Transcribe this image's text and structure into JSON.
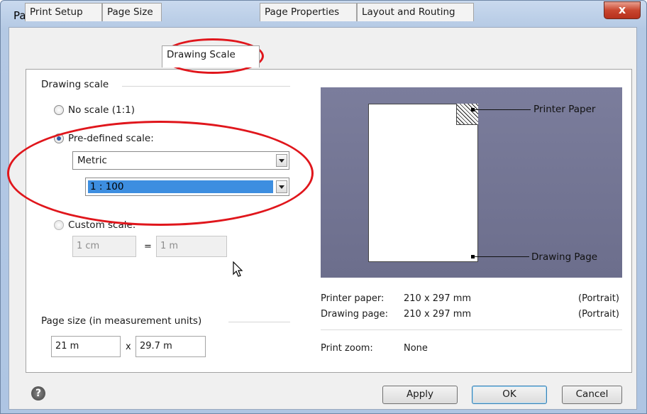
{
  "window": {
    "title": "Page Setup",
    "close_glyph": "x"
  },
  "tabs": [
    {
      "label": "Print Setup"
    },
    {
      "label": "Page Size"
    },
    {
      "label": "Drawing Scale"
    },
    {
      "label": "Page Properties"
    },
    {
      "label": "Layout and Routing"
    }
  ],
  "drawing_scale": {
    "group_label": "Drawing scale",
    "no_scale_label": "No scale (1:1)",
    "predefined_label": "Pre-defined scale:",
    "predefined_type": "Metric",
    "predefined_value": "1 : 100",
    "custom_label": "Custom scale:",
    "custom_left": "1 cm",
    "custom_equals": "=",
    "custom_right": "1 m",
    "selected_option": "predefined"
  },
  "page_size": {
    "group_label": "Page size (in measurement units)",
    "width": "21 m",
    "times": "x",
    "height": "29.7 m"
  },
  "preview": {
    "printer_paper_callout": "Printer Paper",
    "drawing_page_callout": "Drawing Page"
  },
  "info": {
    "printer_paper_label": "Printer paper:",
    "printer_paper_size": "210 x 297 mm",
    "printer_paper_orientation": "(Portrait)",
    "drawing_page_label": "Drawing page:",
    "drawing_page_size": "210 x 297 mm",
    "drawing_page_orientation": "(Portrait)",
    "print_zoom_label": "Print zoom:",
    "print_zoom_value": "None"
  },
  "buttons": {
    "help_glyph": "?",
    "apply": "Apply",
    "ok": "OK",
    "cancel": "Cancel"
  },
  "colors": {
    "annotation_ellipse": "#e0161c",
    "preview_bg": "#6c6e8c",
    "selection": "#3d8ee0"
  }
}
